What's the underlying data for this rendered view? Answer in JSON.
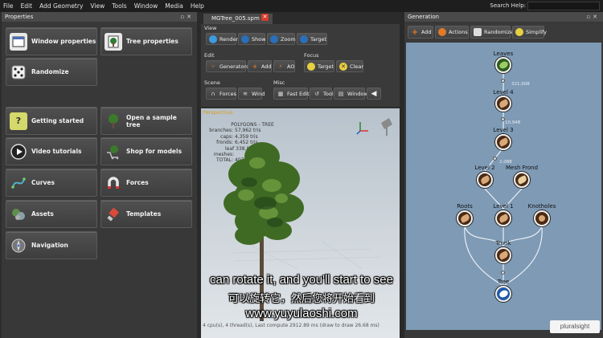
{
  "menubar": {
    "items": [
      "File",
      "Edit",
      "Add Geometry",
      "View",
      "Tools",
      "Window",
      "Media",
      "Help"
    ],
    "search_label": "Search Help:"
  },
  "properties": {
    "title": "Properties",
    "buttons": {
      "window_properties": "Window properties",
      "tree_properties": "Tree properties",
      "randomize": "Randomize",
      "getting_started": "Getting started",
      "open_sample_tree": "Open a sample tree",
      "video_tutorials": "Video tutorials",
      "shop_for_models": "Shop for models",
      "curves": "Curves",
      "forces": "Forces",
      "assets": "Assets",
      "templates": "Templates",
      "navigation": "Navigation"
    }
  },
  "document_tab": {
    "label": "MGTree_005.spm"
  },
  "toolbar": {
    "view": {
      "label": "View",
      "render": "Render",
      "show": "Show",
      "zoom": "Zoom",
      "target": "Target"
    },
    "edit": {
      "label": "Edit",
      "generators": "Generators",
      "add": "Add",
      "ao": "AO"
    },
    "focus": {
      "label": "Focus",
      "target": "Target",
      "clear": "Clear"
    },
    "scene": {
      "label": "Scene",
      "forces": "Forces",
      "wind": "Wind"
    },
    "misc": {
      "label": "Misc",
      "fast_edit": "Fast Edit",
      "tool": "Tool",
      "window": "Window"
    }
  },
  "viewport": {
    "label": "Perspective",
    "stats_header": "POLYGONS - TREE",
    "stats": [
      {
        "k": "branches:",
        "v": "57,962 tris"
      },
      {
        "k": "caps:",
        "v": "4,359 tris"
      },
      {
        "k": "fronds:",
        "v": "6,452 tris"
      },
      {
        "k": "leaf meshes:",
        "v": "338,848 tris"
      },
      {
        "k": "TOTAL:",
        "v": "407,621"
      }
    ],
    "status": "4 cpu(s), 4 thread(s), Last compute 2912.89 ms (draw to draw 26.68 ms)"
  },
  "generation": {
    "title": "Generation",
    "tools": {
      "add": "Add",
      "actions": "Actions",
      "randomize": "Randomize",
      "simplify": "Simplify"
    },
    "nodes": {
      "leaves": "Leaves",
      "level4": "Level 4",
      "level3": "Level 3",
      "level2": "Level 2",
      "mesh_frond": "Mesh Frond",
      "roots": "Roots",
      "level1": "Level 1",
      "knotholes": "Knotholes",
      "trunk": "Trunk",
      "tree": "Tree"
    },
    "counts": {
      "leaves": "321,008",
      "level4": "10,948",
      "level3": "2,088"
    }
  },
  "subtitles": {
    "english": "can rotate it, and you'll start to see",
    "chinese": "可以旋转它，然后您将开始看到",
    "watermark": "www.yuyulaoshi.com"
  },
  "logo": {
    "text": "pluralsight"
  }
}
